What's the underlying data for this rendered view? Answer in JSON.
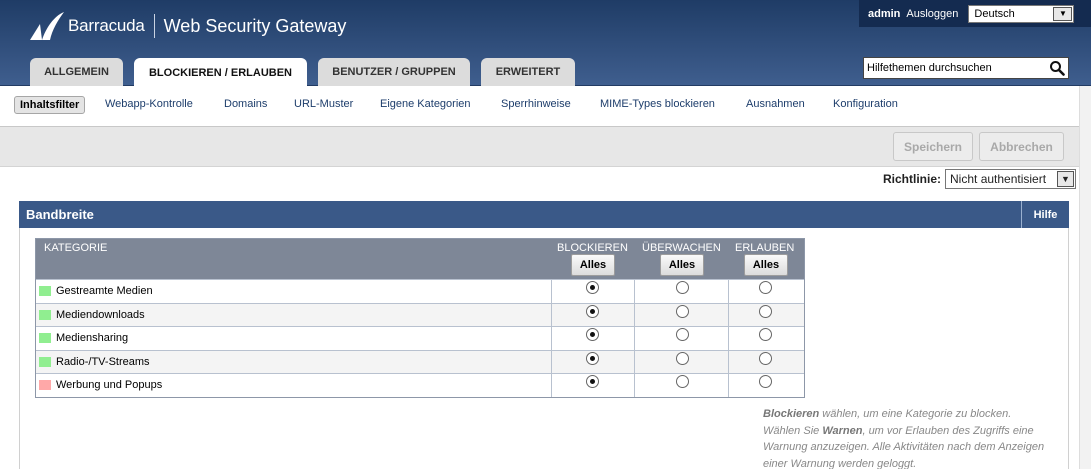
{
  "header": {
    "brand": "Barracuda",
    "product": "Web Security Gateway",
    "username": "admin",
    "logout_label": "Ausloggen",
    "language": "Deutsch",
    "search_value": "Hilfethemen durchsuchen",
    "colors": {
      "header_top": "#1f3c66",
      "userbar": "#142b50"
    }
  },
  "tabs": [
    {
      "label": "ALLGEMEIN"
    },
    {
      "label": "BLOCKIEREN / ERLAUBEN",
      "active": true
    },
    {
      "label": "BENUTZER / GRUPPEN"
    },
    {
      "label": "ERWEITERT"
    }
  ],
  "subnav": [
    {
      "label": "Inhaltsfilter",
      "active": true
    },
    {
      "label": "Webapp-Kontrolle"
    },
    {
      "label": "Domains"
    },
    {
      "label": "URL-Muster"
    },
    {
      "label": "Eigene Kategorien"
    },
    {
      "label": "Sperrhinweise"
    },
    {
      "label": "MIME-Types blockieren"
    },
    {
      "label": "Ausnahmen"
    },
    {
      "label": "Konfiguration"
    }
  ],
  "actions": {
    "save_label": "Speichern",
    "cancel_label": "Abbrechen"
  },
  "policy": {
    "label": "Richtlinie:",
    "value": "Nicht authentisiert"
  },
  "section": {
    "title": "Bandbreite",
    "help_label": "Hilfe",
    "color": "#3a5988"
  },
  "table": {
    "col_category": "KATEGORIE",
    "col_block": "BLOCKIEREN",
    "col_monitor": "ÜBERWACHEN",
    "col_allow": "ERLAUBEN",
    "all_label": "Alles",
    "rows": [
      {
        "name": "Gestreamte Medien",
        "color": "#90ee90",
        "selected": "block"
      },
      {
        "name": "Mediendownloads",
        "color": "#90ee90",
        "selected": "block"
      },
      {
        "name": "Mediensharing",
        "color": "#90ee90",
        "selected": "block"
      },
      {
        "name": "Radio-/TV-Streams",
        "color": "#90ee90",
        "selected": "block"
      },
      {
        "name": "Werbung und Popups",
        "color": "#ffa8a8",
        "selected": "block"
      }
    ]
  },
  "help": {
    "block_word": "Blockieren",
    "block_rest": " wählen, um eine Kategorie zu blocken.",
    "warn_prefix": "Wählen Sie ",
    "warn_word": "Warnen",
    "warn_rest": ", um vor Erlauben des Zugriffs eine Warnung anzuzeigen. Alle Aktivitäten nach dem Anzeigen einer Warnung werden geloggt."
  }
}
